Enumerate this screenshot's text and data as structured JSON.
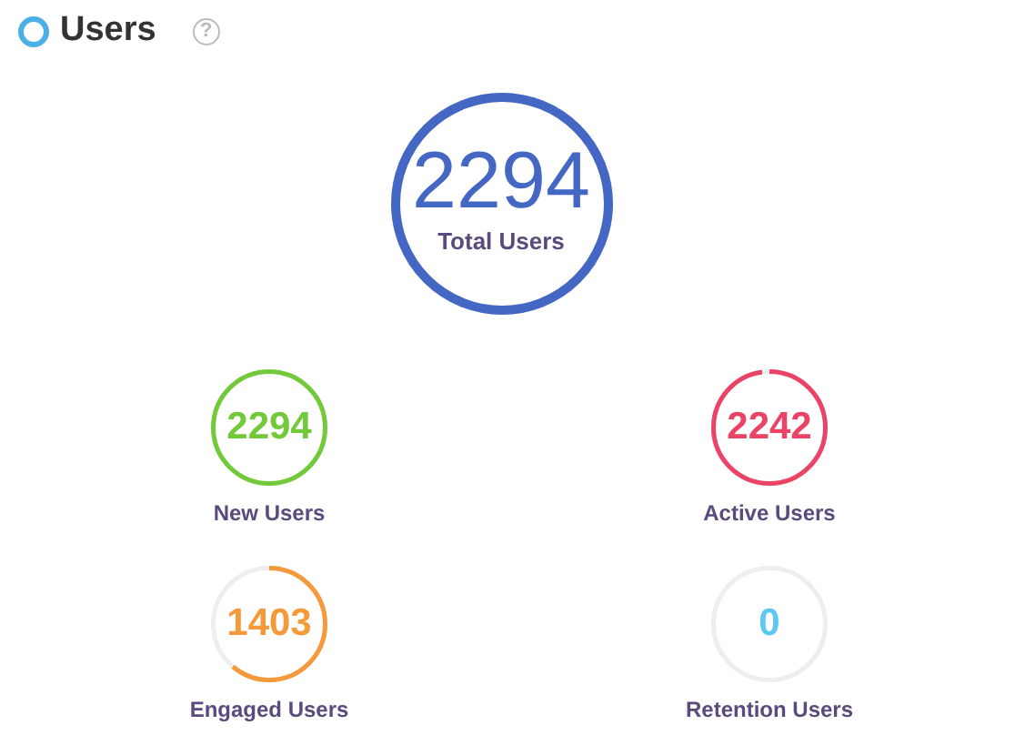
{
  "header": {
    "title": "Users",
    "help_icon": "?"
  },
  "total": {
    "value": "2294",
    "label": "Total Users",
    "color": "#4467c4"
  },
  "metrics": [
    {
      "value": "2294",
      "label": "New Users",
      "color": "#72c93a"
    },
    {
      "value": "2242",
      "label": "Active Users",
      "color": "#ea4366"
    },
    {
      "value": "1403",
      "label": "Engaged Users",
      "color": "#f59a3b"
    },
    {
      "value": "0",
      "label": "Retention Users",
      "color": "#5ec8f2"
    }
  ]
}
